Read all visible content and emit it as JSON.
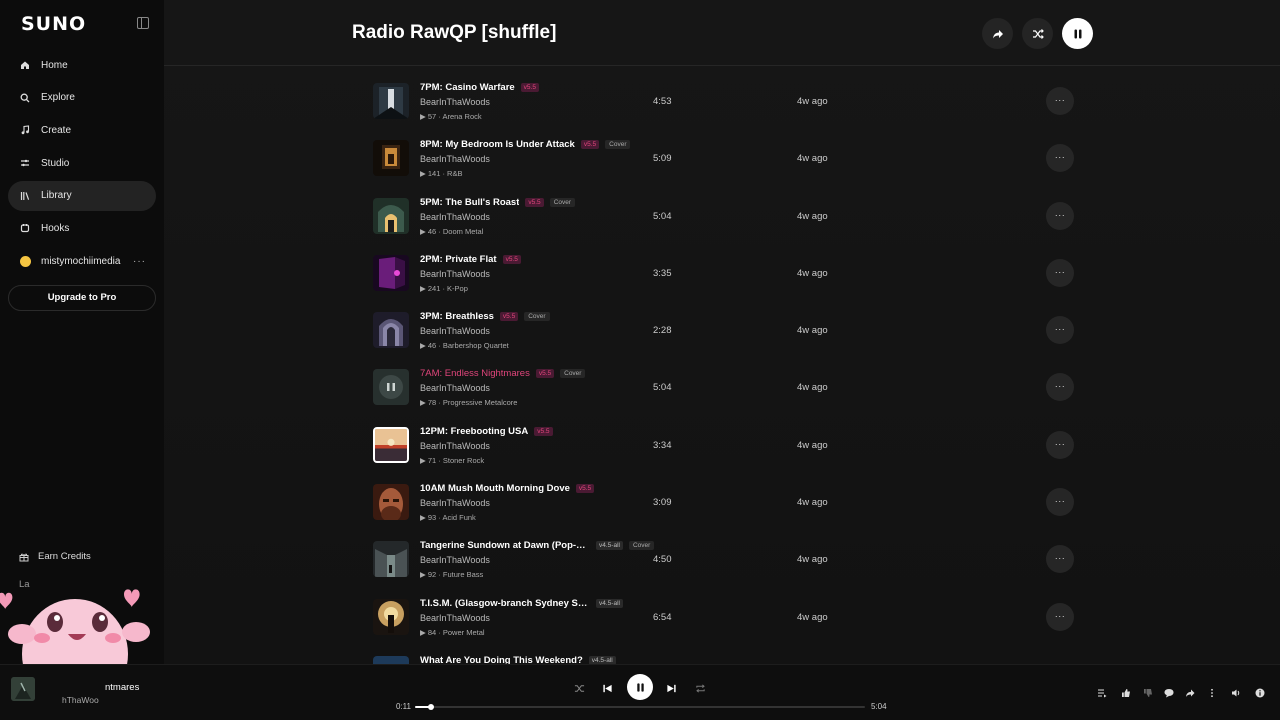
{
  "app": {
    "logo": "SUNO"
  },
  "sidebar": {
    "items": [
      {
        "label": "Home",
        "icon": "home-icon"
      },
      {
        "label": "Explore",
        "icon": "search-icon"
      },
      {
        "label": "Create",
        "icon": "music-note-icon"
      },
      {
        "label": "Studio",
        "icon": "studio-icon"
      },
      {
        "label": "Library",
        "icon": "library-icon",
        "active": true
      },
      {
        "label": "Hooks",
        "icon": "hooks-icon"
      }
    ],
    "user": {
      "name": "mistymochiimedia",
      "more": "···"
    },
    "upgrade_label": "Upgrade to Pro",
    "earn_label": "Earn Credits",
    "labs_label": "La"
  },
  "header": {
    "title": "Radio RawQP [shuffle]"
  },
  "tracks": [
    {
      "title": "7PM: Casino Warfare",
      "version": "v5.5",
      "cover": "",
      "artist": "BearInThaWoods",
      "meta": "▶ 57 · Arena Rock",
      "duration": "4:53",
      "ago": "4w ago",
      "art": "casino"
    },
    {
      "title": "8PM: My Bedroom Is Under Attack",
      "version": "v5.5",
      "cover": "Cover",
      "artist": "BearInThaWoods",
      "meta": "▶ 141 · R&B",
      "duration": "5:09",
      "ago": "4w ago",
      "art": "bedroom"
    },
    {
      "title": "5PM: The Bull's Roast",
      "version": "v5.5",
      "cover": "Cover",
      "artist": "BearInThaWoods",
      "meta": "▶ 46 · Doom Metal",
      "duration": "5:04",
      "ago": "4w ago",
      "art": "bull"
    },
    {
      "title": "2PM: Private Flat",
      "version": "v5.5",
      "cover": "",
      "artist": "BearInThaWoods",
      "meta": "▶ 241 · K-Pop",
      "duration": "3:35",
      "ago": "4w ago",
      "art": "flat"
    },
    {
      "title": "3PM: Breathless",
      "version": "v5.5",
      "cover": "Cover",
      "artist": "BearInThaWoods",
      "meta": "▶ 46 · Barbershop Quartet",
      "duration": "2:28",
      "ago": "4w ago",
      "art": "breathless"
    },
    {
      "title": "7AM: Endless Nightmares",
      "version": "v5.5",
      "cover": "Cover",
      "artist": "BearInThaWoods",
      "meta": "▶ 78 · Progressive Metalcore",
      "duration": "5:04",
      "ago": "4w ago",
      "art": "nightmares",
      "playing": true
    },
    {
      "title": "12PM: Freebooting USA",
      "version": "v5.5",
      "cover": "",
      "artist": "BearInThaWoods",
      "meta": "▶ 71 · Stoner Rock",
      "duration": "3:34",
      "ago": "4w ago",
      "art": "freebooting",
      "selected": true
    },
    {
      "title": "10AM Mush Mouth Morning Dove",
      "version": "v5.5",
      "cover": "",
      "artist": "BearInThaWoods",
      "meta": "▶ 93 · Acid Funk",
      "duration": "3:09",
      "ago": "4w ago",
      "art": "mush"
    },
    {
      "title": "Tangerine Sundown at Dawn (Pop-pu...",
      "version": "v4.5-all",
      "cover": "Cover",
      "artist": "BearInThaWoods",
      "meta": "▶ 92 · Future Bass",
      "duration": "4:50",
      "ago": "4w ago",
      "art": "tangerine",
      "alt": true
    },
    {
      "title": "T.I.S.M. (Glasgow-branch Sydney Symphony ...",
      "version": "v4.5-all",
      "cover": "",
      "artist": "BearInThaWoods",
      "meta": "▶ 84 · Power Metal",
      "duration": "6:54",
      "ago": "4w ago",
      "art": "tism",
      "alt": true
    },
    {
      "title": "What Are You Doing This Weekend?",
      "version": "v4.5-all",
      "cover": "",
      "artist": "",
      "meta": "",
      "duration": "",
      "ago": "",
      "art": "weekend",
      "alt": true
    }
  ],
  "player": {
    "title": "ntmares",
    "artist": "hThaWoo",
    "current_time": "0:11",
    "total_time": "5:04",
    "progress": 0.036
  },
  "colors": {
    "accent": "#e0457b",
    "background": "#101010"
  }
}
